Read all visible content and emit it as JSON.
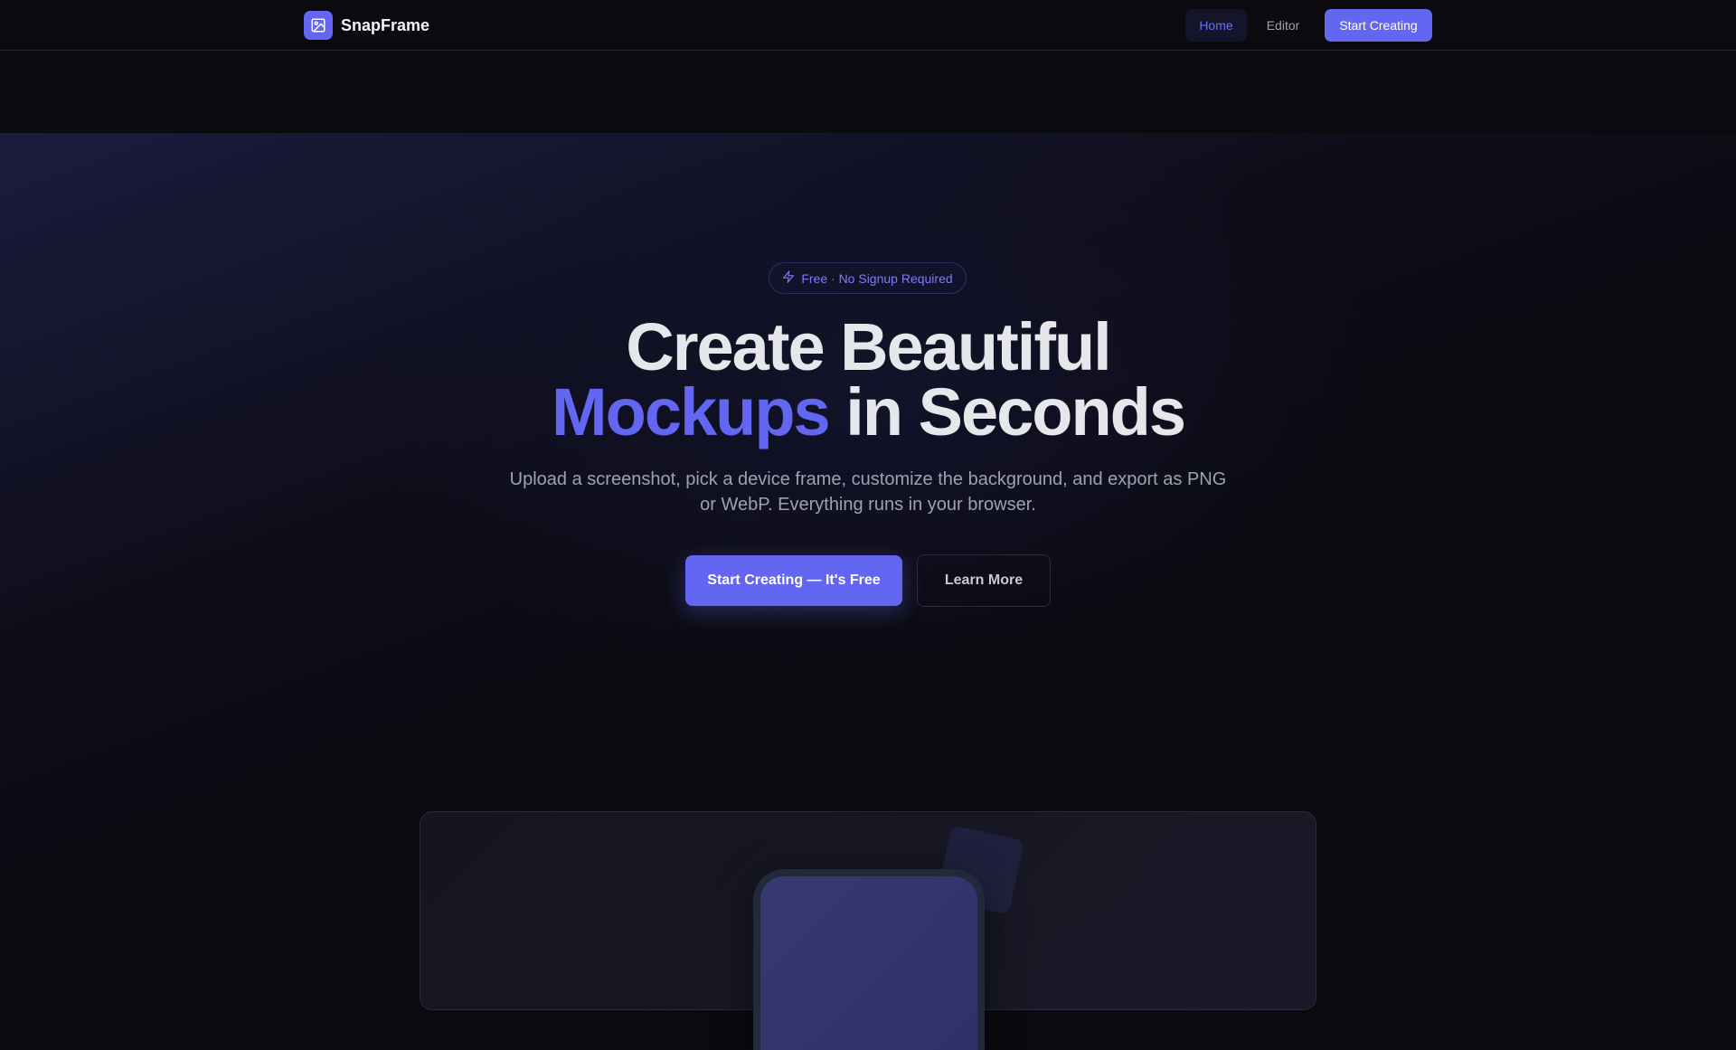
{
  "nav": {
    "brand": "SnapFrame",
    "links": [
      {
        "label": "Home",
        "active": true
      },
      {
        "label": "Editor"
      }
    ],
    "cta": "Start Creating"
  },
  "hero": {
    "badge": "Free · No Signup Required",
    "title_line1": "Create Beautiful",
    "title_accent": "Mockups",
    "title_rest": " in Seconds",
    "subtitle": "Upload a screenshot, pick a device frame, customize the background, and export as PNG or WebP. Everything runs in your browser.",
    "primary_button": "Start Creating — It's Free",
    "secondary_button": "Learn More"
  },
  "colors": {
    "accent": "#6366f1",
    "background": "#0a0a0f"
  }
}
